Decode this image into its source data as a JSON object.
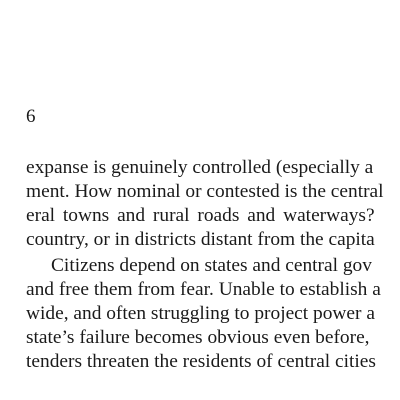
{
  "page": {
    "page_number": "6",
    "lines": [
      "expanse is genuinely controlled (especially a",
      "ment. How nominal or contested is the central",
      "eral towns and rural roads and waterways?",
      "country, or in districts distant from the capita",
      "Citizens depend on states and central gov",
      "and free them from fear. Unable to establish a",
      "wide, and often struggling to project power a",
      "state’s failure becomes obvious even before,",
      "tenders threaten the residents of central cities"
    ]
  }
}
